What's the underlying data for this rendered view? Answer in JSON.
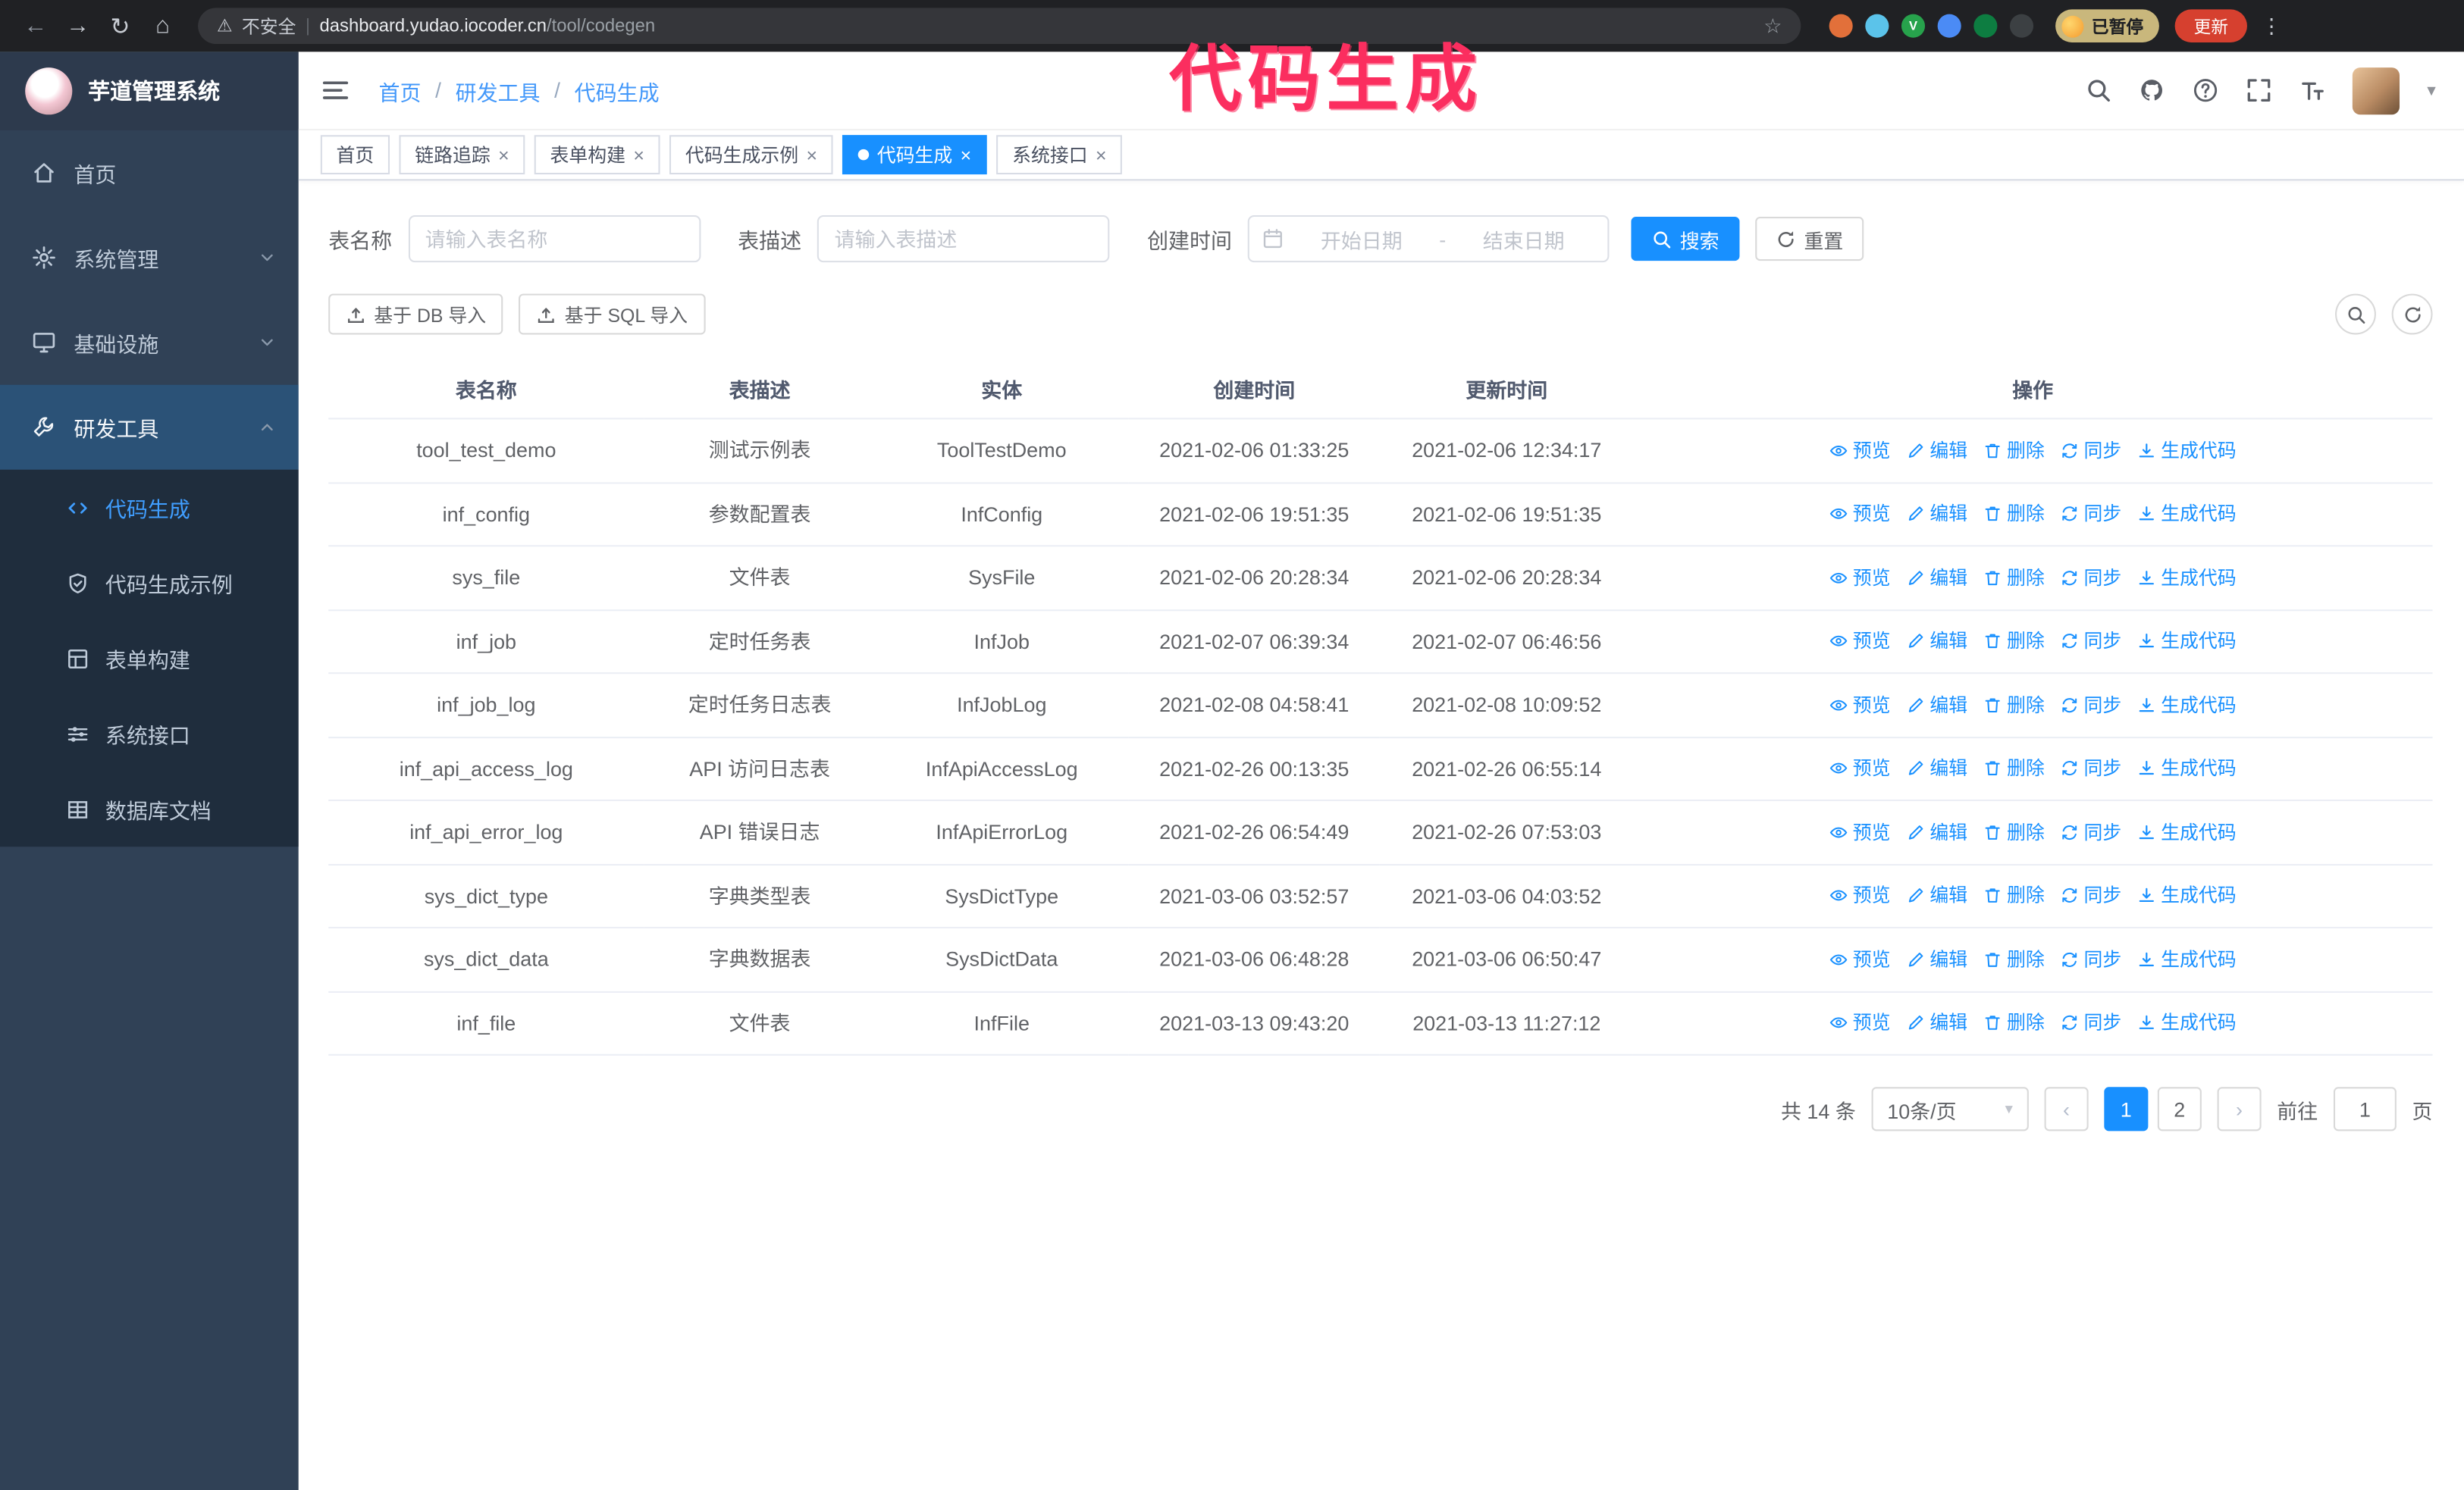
{
  "glyphs": {
    "back": "←",
    "forward": "→",
    "reload": "↻",
    "home": "⌂",
    "warning": "⚠",
    "divider": "|",
    "star": "☆",
    "kebab": "⋮",
    "caret_down": "▾",
    "close": "×",
    "prev": "‹",
    "next": "›",
    "separator": "/"
  },
  "browser": {
    "security_label": "不安全",
    "url_host": "dashboard.yudao.iocoder.cn",
    "url_path": "/tool/codegen",
    "paused_badge": "已暂停",
    "update_button": "更新",
    "extensions": [
      {
        "color": "#e2703a"
      },
      {
        "color": "#5bc3ea"
      },
      {
        "color": "#27a24c",
        "letter": "V"
      },
      {
        "color": "#4b8bf5"
      },
      {
        "color": "#0d7d41"
      },
      {
        "color": "#3c4043"
      }
    ]
  },
  "annotation": "代码生成",
  "sidebar": {
    "logo_title": "芋道管理系统",
    "items": [
      {
        "label": "首页",
        "icon": "home"
      },
      {
        "label": "系统管理",
        "icon": "system",
        "expandable": true
      },
      {
        "label": "基础设施",
        "icon": "infra",
        "expandable": true
      },
      {
        "label": "研发工具",
        "icon": "tools",
        "expandable": true,
        "expanded": true
      }
    ],
    "subitems": [
      {
        "label": "代码生成",
        "icon": "code",
        "active": true
      },
      {
        "label": "代码生成示例",
        "icon": "example"
      },
      {
        "label": "表单构建",
        "icon": "form"
      },
      {
        "label": "系统接口",
        "icon": "api"
      },
      {
        "label": "数据库文档",
        "icon": "db"
      }
    ]
  },
  "header": {
    "breadcrumb": [
      "首页",
      "研发工具",
      "代码生成"
    ]
  },
  "tabs": [
    {
      "label": "首页",
      "closable": false
    },
    {
      "label": "链路追踪",
      "closable": true
    },
    {
      "label": "表单构建",
      "closable": true
    },
    {
      "label": "代码生成示例",
      "closable": true
    },
    {
      "label": "代码生成",
      "closable": true,
      "active": true
    },
    {
      "label": "系统接口",
      "closable": true
    }
  ],
  "filters": {
    "table_name_label": "表名称",
    "table_name_placeholder": "请输入表名称",
    "table_desc_label": "表描述",
    "table_desc_placeholder": "请输入表描述",
    "create_time_label": "创建时间",
    "date_start_placeholder": "开始日期",
    "date_separator": "-",
    "date_end_placeholder": "结束日期",
    "search_button": "搜索",
    "reset_button": "重置"
  },
  "toolbar": {
    "import_db_button": "基于 DB 导入",
    "import_sql_button": "基于 SQL 导入"
  },
  "table": {
    "columns": [
      "表名称",
      "表描述",
      "实体",
      "创建时间",
      "更新时间",
      "操作"
    ],
    "actions": [
      "预览",
      "编辑",
      "删除",
      "同步",
      "生成代码"
    ],
    "rows": [
      {
        "name": "tool_test_demo",
        "desc": "测试示例表",
        "entity": "ToolTestDemo",
        "created": "2021-02-06 01:33:25",
        "updated": "2021-02-06 12:34:17"
      },
      {
        "name": "inf_config",
        "desc": "参数配置表",
        "entity": "InfConfig",
        "created": "2021-02-06 19:51:35",
        "updated": "2021-02-06 19:51:35"
      },
      {
        "name": "sys_file",
        "desc": "文件表",
        "entity": "SysFile",
        "created": "2021-02-06 20:28:34",
        "updated": "2021-02-06 20:28:34"
      },
      {
        "name": "inf_job",
        "desc": "定时任务表",
        "entity": "InfJob",
        "created": "2021-02-07 06:39:34",
        "updated": "2021-02-07 06:46:56"
      },
      {
        "name": "inf_job_log",
        "desc": "定时任务日志表",
        "entity": "InfJobLog",
        "created": "2021-02-08 04:58:41",
        "updated": "2021-02-08 10:09:52"
      },
      {
        "name": "inf_api_access_log",
        "desc": "API 访问日志表",
        "entity": "InfApiAccessLog",
        "created": "2021-02-26 00:13:35",
        "updated": "2021-02-26 06:55:14"
      },
      {
        "name": "inf_api_error_log",
        "desc": "API 错误日志",
        "entity": "InfApiErrorLog",
        "created": "2021-02-26 06:54:49",
        "updated": "2021-02-26 07:53:03"
      },
      {
        "name": "sys_dict_type",
        "desc": "字典类型表",
        "entity": "SysDictType",
        "created": "2021-03-06 03:52:57",
        "updated": "2021-03-06 04:03:52"
      },
      {
        "name": "sys_dict_data",
        "desc": "字典数据表",
        "entity": "SysDictData",
        "created": "2021-03-06 06:48:28",
        "updated": "2021-03-06 06:50:47"
      },
      {
        "name": "inf_file",
        "desc": "文件表",
        "entity": "InfFile",
        "created": "2021-03-13 09:43:20",
        "updated": "2021-03-13 11:27:12"
      }
    ]
  },
  "pagination": {
    "total": "共 14 条",
    "page_size": "10条/页",
    "pages": [
      {
        "label": "1",
        "active": true
      },
      {
        "label": "2"
      }
    ],
    "goto_label": "前往",
    "goto_value": "1",
    "goto_suffix": "页"
  },
  "colors": {
    "primary": "#1890ff",
    "sidebar-bg": "#304156",
    "submenu-bg": "#1f2d3d",
    "annotation": "#fb2e5f",
    "update-red": "#d6402f",
    "paused-tan": "#c9b77c"
  }
}
